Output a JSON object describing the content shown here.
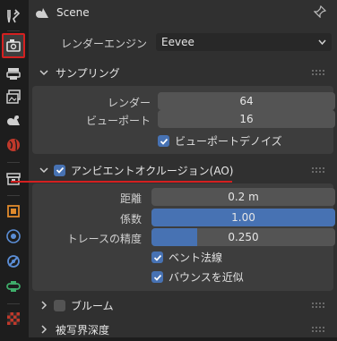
{
  "header": {
    "title": "Scene"
  },
  "render_engine": {
    "label": "レンダーエンジン",
    "value": "Eevee"
  },
  "sampling": {
    "title": "サンプリング",
    "render_label": "レンダー",
    "render_value": "64",
    "viewport_label": "ビューポート",
    "viewport_value": "16",
    "denoise_label": "ビューポートデノイズ",
    "denoise_checked": true
  },
  "ao": {
    "title": "アンビエントオクルージョン(AO)",
    "enabled": true,
    "distance_label": "距離",
    "distance_value": "0.2 m",
    "factor_label": "係数",
    "factor_value": "1.00",
    "factor_fill": 1.0,
    "precision_label": "トレースの精度",
    "precision_value": "0.250",
    "precision_fill": 0.25,
    "bent_normals_label": "ベント法線",
    "bent_normals_checked": true,
    "bounce_label": "バウンスを近似",
    "bounce_checked": true
  },
  "bloom": {
    "title": "ブルーム",
    "enabled": false
  },
  "dof": {
    "title": "被写界深度"
  },
  "colors": {
    "accent": "#4772b3",
    "highlight": "#d42020"
  }
}
